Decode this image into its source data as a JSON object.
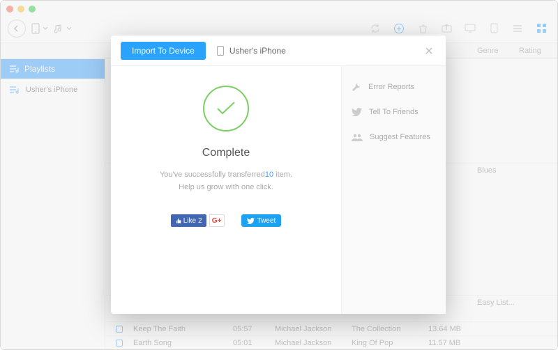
{
  "columns": {
    "genre": "Genre",
    "rating": "Rating"
  },
  "sidebar": {
    "header": "Playlists",
    "items": [
      {
        "label": "Usher's iPhone"
      }
    ]
  },
  "tracks": [
    {
      "name": "",
      "time": "",
      "artist": "",
      "album": "",
      "size": "",
      "genre": "Blues"
    },
    {
      "name": "",
      "time": "",
      "artist": "",
      "album": "",
      "size": "",
      "genre": "Easy List..."
    },
    {
      "name": "Keep The Faith",
      "time": "05:57",
      "artist": "Michael Jackson",
      "album": "The Collection",
      "size": "13.64 MB",
      "genre": ""
    },
    {
      "name": "Earth Song",
      "time": "05:01",
      "artist": "Michael Jackson",
      "album": "King Of Pop",
      "size": "11.57 MB",
      "genre": ""
    }
  ],
  "modal": {
    "import_label": "Import To Device",
    "device_name": "Usher's iPhone",
    "title": "Complete",
    "sub_prefix": "You've successfully transferred",
    "count": "10",
    "sub_suffix": " item.",
    "sub_line2": "Help us grow with one click.",
    "fb_label": "Like",
    "fb_count": "2",
    "gplus_label": "G+",
    "tweet_label": "Tweet",
    "side": {
      "error": "Error Reports",
      "tell": "Tell To Friends",
      "suggest": "Suggest Features"
    }
  }
}
